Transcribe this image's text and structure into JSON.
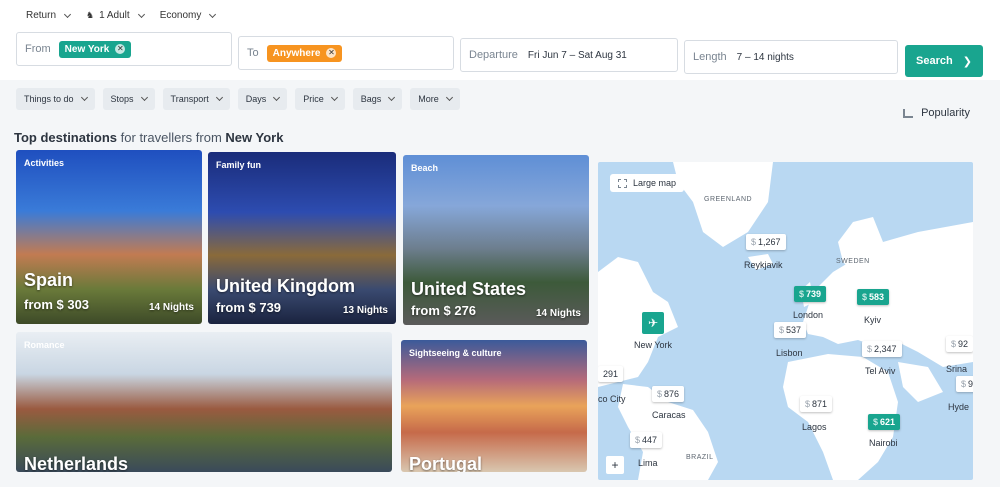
{
  "trip_options": {
    "trip_type": "Return",
    "passengers": "1 Adult",
    "cabin": "Economy"
  },
  "search": {
    "from_label": "From",
    "from_value": "New York",
    "to_label": "To",
    "to_value": "Anywhere",
    "departure_label": "Departure",
    "departure_value": "Fri Jun 7 – Sat Aug 31",
    "length_label": "Length",
    "length_value": "7 – 14 nights",
    "search_button": "Search"
  },
  "filters": [
    "Things to do",
    "Stops",
    "Transport",
    "Days",
    "Price",
    "Bags",
    "More"
  ],
  "sort": {
    "label": "Popularity"
  },
  "heading": {
    "prefix": "Top destinations",
    "middle": " for travellers from ",
    "city": "New York"
  },
  "cards": [
    {
      "tag": "Activities",
      "name": "Spain",
      "price": "from $ 303",
      "nights": "14 Nights"
    },
    {
      "tag": "Family fun",
      "name": "United Kingdom",
      "price": "from $ 739",
      "nights": "13 Nights"
    },
    {
      "tag": "Beach",
      "name": "United States",
      "price": "from $ 276",
      "nights": "14 Nights"
    },
    {
      "tag": "Romance",
      "name": "Netherlands"
    },
    {
      "tag": "Sightseeing & culture",
      "name": "Portugal"
    }
  ],
  "map": {
    "large_map_label": "Large map",
    "regions": [
      "GREENLAND",
      "SWEDEN",
      "BRAZIL"
    ],
    "cities": [
      "New York",
      "Reykjavik",
      "London",
      "Kyiv",
      "Lisbon",
      "Tel Aviv",
      "Caracas",
      "Lagos",
      "Nairobi",
      "Lima",
      "Srina",
      "Hyde",
      "co City"
    ],
    "currency": "$",
    "prices": [
      {
        "value": "1,267",
        "hot": false
      },
      {
        "value": "739",
        "hot": true
      },
      {
        "value": "583",
        "hot": true
      },
      {
        "value": "537",
        "hot": false
      },
      {
        "value": "2,347",
        "hot": false
      },
      {
        "value": "876",
        "hot": false
      },
      {
        "value": "871",
        "hot": false
      },
      {
        "value": "621",
        "hot": true
      },
      {
        "value": "447",
        "hot": false
      },
      {
        "value": "291",
        "hot": false
      },
      {
        "value": "92",
        "hot": false
      },
      {
        "value": "9",
        "hot": false
      }
    ],
    "colors": {
      "water": "#b9d8f2",
      "land": "#ffffff",
      "accent": "#19a58f"
    }
  },
  "colors": {
    "accent_green": "#19a58f",
    "accent_orange": "#f79420"
  }
}
